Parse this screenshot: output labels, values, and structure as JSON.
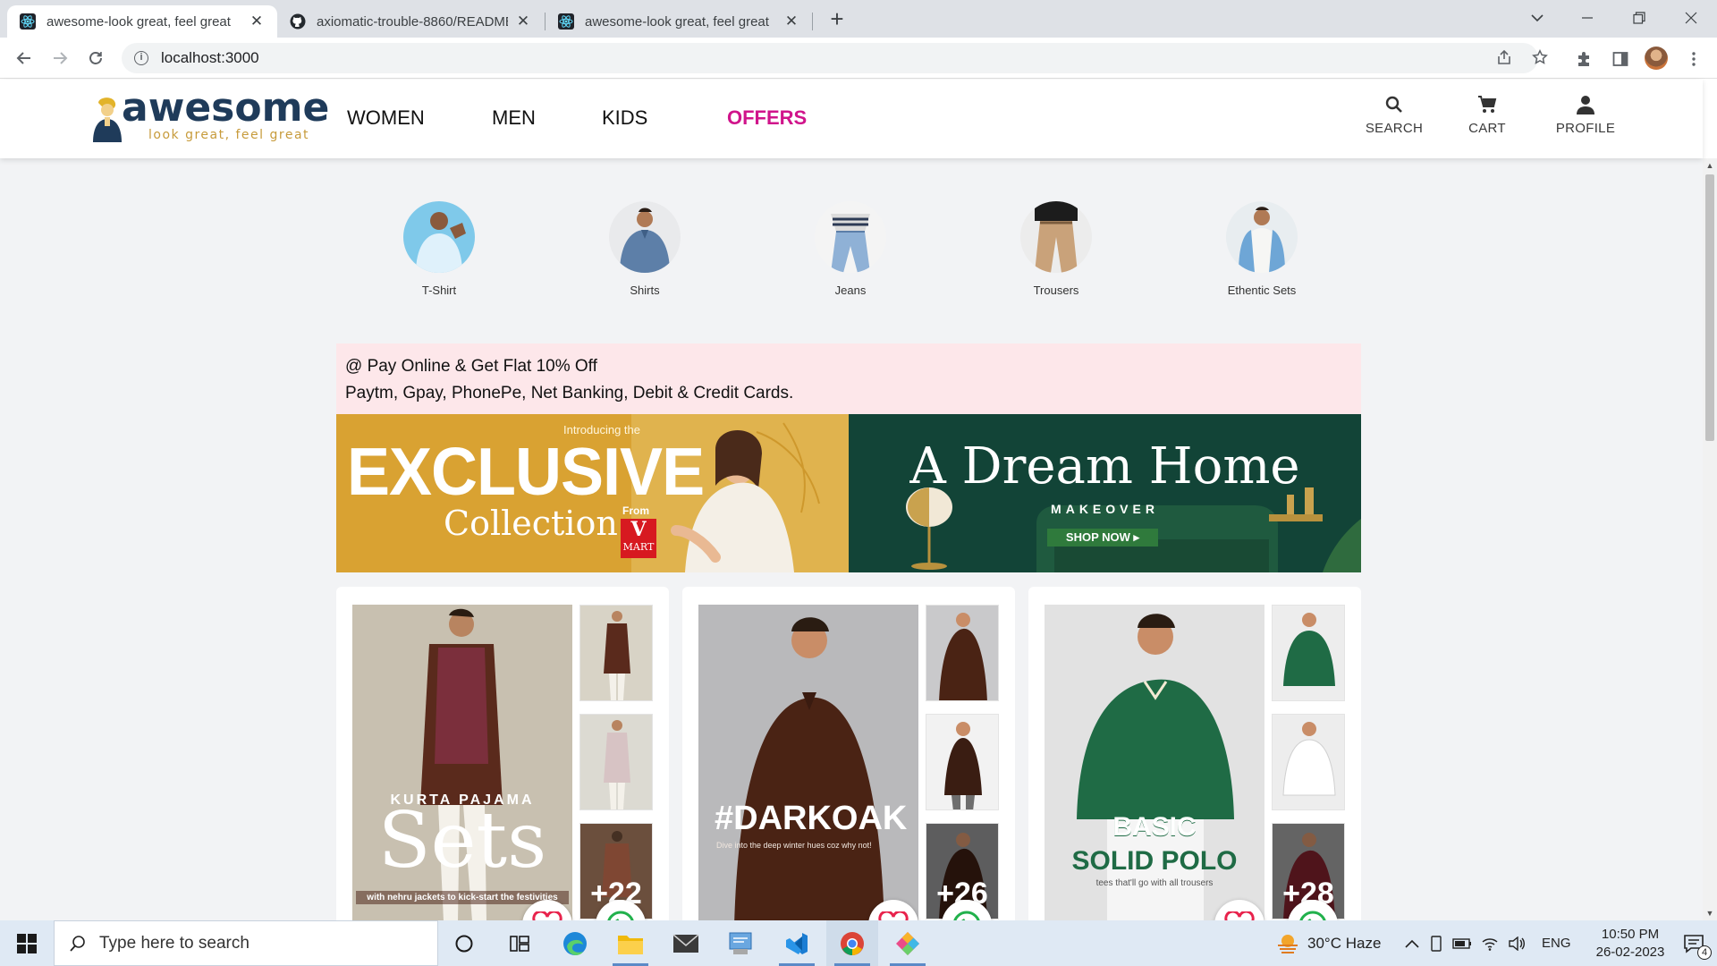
{
  "browser": {
    "tabs": [
      {
        "title": "awesome-look great, feel great",
        "active": true
      },
      {
        "title": "axiomatic-trouble-8860/README",
        "active": false
      },
      {
        "title": "awesome-look great, feel great",
        "active": false
      }
    ],
    "url": "localhost:3000"
  },
  "site": {
    "logo_text": "awesome",
    "logo_tagline": "look great, feel great",
    "nav": [
      "WOMEN",
      "MEN",
      "KIDS",
      "OFFERS"
    ],
    "actions": {
      "search": "SEARCH",
      "cart": "CART",
      "profile": "PROFILE"
    },
    "accent_color": "#d0148b"
  },
  "categories": [
    "T-Shirt",
    "Shirts",
    "Jeans",
    "Trousers",
    "Ethentic Sets"
  ],
  "offer_band": {
    "line1": "@ Pay Online & Get Flat 10% Off",
    "line2": "Paytm, Gpay, PhonePe, Net Banking, Debit & Credit Cards."
  },
  "banners": {
    "left": {
      "intro": "Introducing the",
      "headline": "EXCLUSIVE",
      "subhead": "Collection",
      "from": "From",
      "brand_line1": "V",
      "brand_line2": "MART"
    },
    "right": {
      "headline": "A Dream Home",
      "subhead": "MAKEOVER",
      "cta": "SHOP NOW ▸"
    }
  },
  "products": [
    {
      "overlay_top": "KURTA PAJAMA",
      "overlay_big": "Sets",
      "overlay_bottom": "with nehru jackets to kick-start the festivities",
      "more": "+22"
    },
    {
      "overlay_big": "#DARKOAK",
      "overlay_bottom": "Dive into the deep winter hues coz why not!",
      "more": "+26"
    },
    {
      "overlay_top": "BASIC",
      "overlay_big": "SOLID POLO",
      "overlay_bottom": "tees that'll go with all trousers",
      "more": "+28"
    }
  ],
  "taskbar": {
    "search_placeholder": "Type here to search",
    "weather": "30°C  Haze",
    "lang": "ENG",
    "time": "10:50 PM",
    "date": "26-02-2023",
    "notification_count": "4"
  }
}
